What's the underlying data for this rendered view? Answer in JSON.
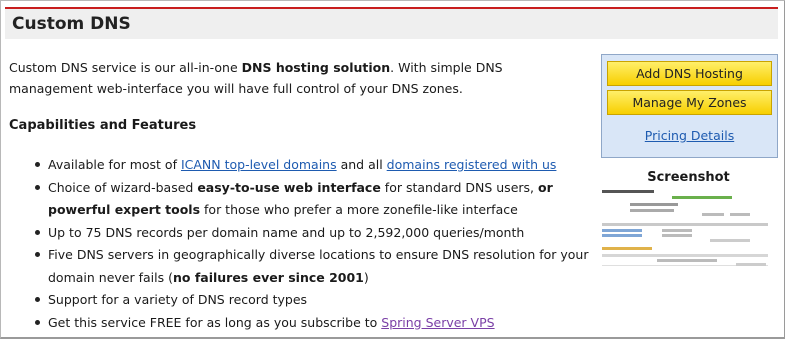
{
  "page": {
    "title": "Custom DNS"
  },
  "intro": {
    "part1": "Custom DNS service is our all-in-one ",
    "bold": "DNS hosting solution",
    "part2": ". With simple DNS management web-interface you will have full control of your DNS zones."
  },
  "features": {
    "heading": "Capabilities and Features",
    "item1": {
      "pre": "Available for most of ",
      "link1": "ICANN top-level domains",
      "mid": " and all ",
      "link2": "domains registered with us"
    },
    "item2": {
      "pre": "Choice of wizard-based ",
      "bold1": "easy-to-use web interface",
      "mid": " for standard DNS users, ",
      "bold2": "or powerful expert tools",
      "post": " for those who prefer a more zonefile-like interface"
    },
    "item3": {
      "text": "Up to 75 DNS records per domain name and up to 2,592,000 queries/month"
    },
    "item4": {
      "pre": "Five DNS servers in geographically diverse locations to ensure DNS resolution for your domain never fails (",
      "bold": "no failures ever since 2001",
      "post": ")"
    },
    "item5": {
      "text": "Support for a variety of DNS record types"
    },
    "item6": {
      "pre": "Get this service FREE for as long as you subscribe to ",
      "link": "Spring Server VPS"
    }
  },
  "sidebar": {
    "add_button": "Add DNS Hosting",
    "manage_button": "Manage My Zones",
    "pricing_link": "Pricing Details",
    "screenshot_title": "Screenshot"
  },
  "colors": {
    "accent_red": "#c81e1e",
    "link_blue": "#1e5bb0",
    "button_yellow": "#f7cf00",
    "sidebar_bg": "#d9e6f7"
  }
}
